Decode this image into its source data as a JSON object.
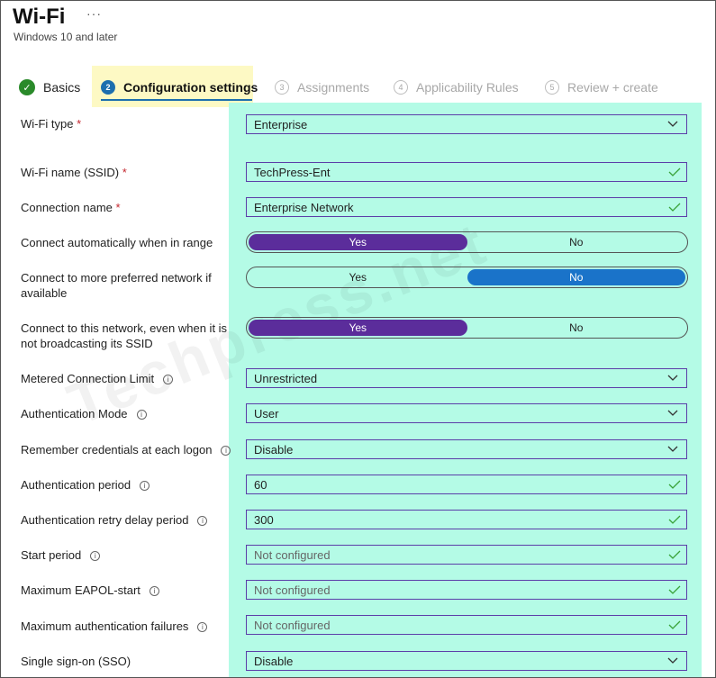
{
  "header": {
    "title": "Wi-Fi",
    "more": "···",
    "subtitle": "Windows 10 and later"
  },
  "tabs": [
    {
      "num": "✓",
      "label": "Basics"
    },
    {
      "num": "2",
      "label": "Configuration settings"
    },
    {
      "num": "3",
      "label": "Assignments"
    },
    {
      "num": "4",
      "label": "Applicability Rules"
    },
    {
      "num": "5",
      "label": "Review + create"
    }
  ],
  "watermark": "Techpress.net",
  "required_mark": "*",
  "info_glyph": "i",
  "toggle_labels": {
    "yes": "Yes",
    "no": "No"
  },
  "fields": {
    "wifi_type": {
      "label": "Wi-Fi type",
      "value": "Enterprise"
    },
    "ssid": {
      "label": "Wi-Fi name (SSID)",
      "value": "TechPress-Ent"
    },
    "connection_name": {
      "label": "Connection name",
      "value": "Enterprise Network"
    },
    "connect_auto": {
      "label": "Connect automatically when in range",
      "selected": "Yes"
    },
    "preferred": {
      "label": "Connect to more preferred network if available",
      "selected": "No"
    },
    "hidden": {
      "label": "Connect to this network, even when it is not broadcasting its SSID",
      "selected": "Yes"
    },
    "metered": {
      "label": "Metered Connection Limit",
      "value": "Unrestricted"
    },
    "auth_mode": {
      "label": "Authentication Mode",
      "value": "User"
    },
    "remember_creds": {
      "label": "Remember credentials at each logon",
      "value": "Disable"
    },
    "auth_period": {
      "label": "Authentication period",
      "value": "60"
    },
    "auth_retry": {
      "label": "Authentication retry delay period",
      "value": "300"
    },
    "start_period": {
      "label": "Start period",
      "placeholder": "Not configured"
    },
    "max_eapol": {
      "label": "Maximum EAPOL-start",
      "placeholder": "Not configured"
    },
    "max_auth_fail": {
      "label": "Maximum authentication failures",
      "placeholder": "Not configured"
    },
    "sso": {
      "label": "Single sign-on (SSO)",
      "value": "Disable"
    }
  },
  "colors": {
    "accent_blue": "#1d6fae",
    "toggle_purple": "#5b2d9b",
    "toggle_blue": "#1a73c9",
    "field_border": "#5b3ea8",
    "highlight_mint": "#b4fbe6",
    "highlight_yellow": "#fdf9c4",
    "check_green": "#2a8a2a",
    "required_red": "#c4262e"
  }
}
